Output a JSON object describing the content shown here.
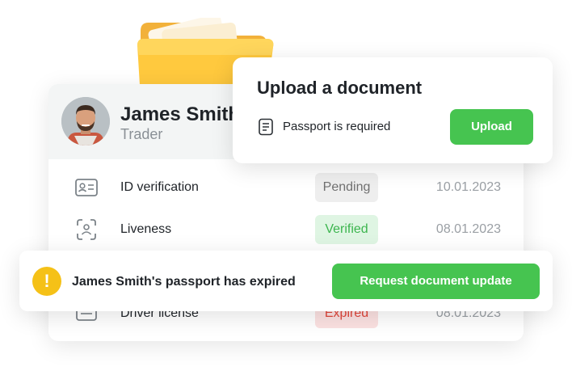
{
  "profile": {
    "name": "James Smith",
    "role": "Trader",
    "documents": [
      {
        "name": "ID verification",
        "status": "Pending",
        "date": "10.01.2023",
        "icon": "id-card-icon"
      },
      {
        "name": "Liveness",
        "status": "Verified",
        "date": "08.01.2023",
        "icon": "face-scan-icon"
      },
      {
        "name": "Driver license",
        "status": "Expired",
        "date": "08.01.2023",
        "icon": "driver-license-icon"
      }
    ]
  },
  "upload": {
    "title": "Upload a document",
    "requirement": "Passport is required",
    "button_label": "Upload"
  },
  "alert": {
    "message": "James Smith's passport has expired",
    "button_label": "Request document update",
    "icon_glyph": "!"
  },
  "colors": {
    "accent_green": "#46c450",
    "warning_yellow": "#f5c117",
    "expired_red": "#e0463b",
    "verified_green": "#3cb54e"
  }
}
